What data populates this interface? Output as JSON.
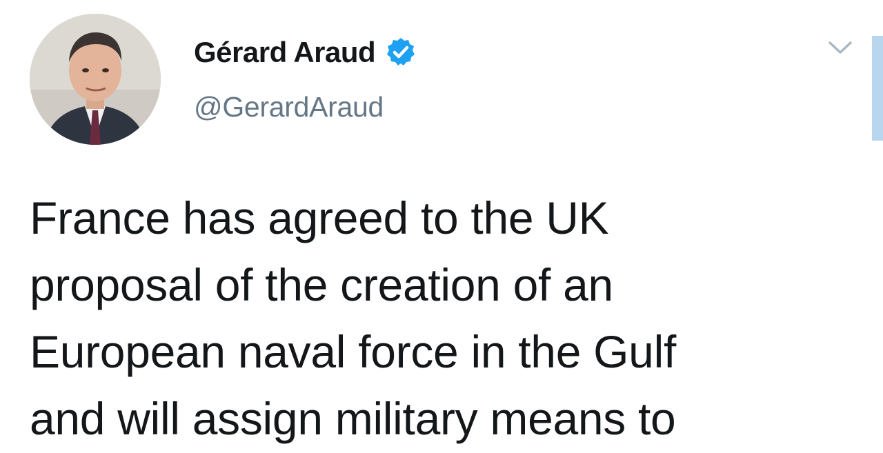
{
  "author": {
    "display_name": "Gérard Araud",
    "handle": "@GerardAraud",
    "verified": true,
    "avatar_icon": "profile-photo"
  },
  "tweet": {
    "text_lines": [
      "France has agreed to the UK",
      "proposal of the creation of an",
      "European naval force in the Gulf",
      "and will assign military means to"
    ]
  },
  "icons": {
    "verified": "verified-badge-icon",
    "more": "chevron-down-icon"
  },
  "colors": {
    "verified_blue": "#1da1f2",
    "handle_gray": "#657786",
    "text": "#14171a",
    "scroll_accent": "#b8d7ee"
  }
}
